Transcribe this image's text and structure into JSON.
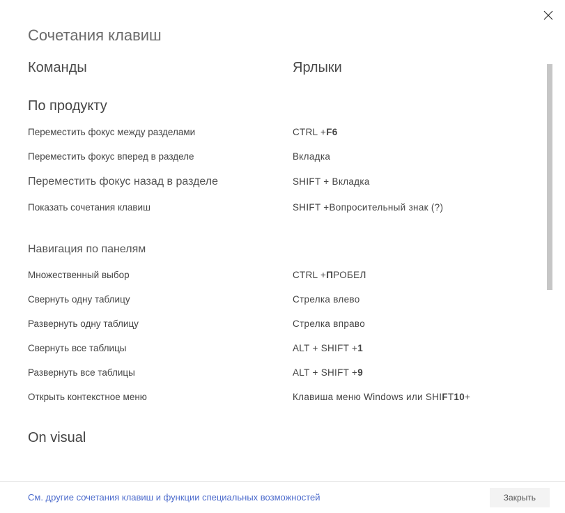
{
  "title": "Сочетания клавиш",
  "headers": {
    "commands": "Команды",
    "shortcuts": "Ярлыки"
  },
  "section1": {
    "title": "По продукту",
    "rows": [
      {
        "cmd": "Переместить фокус между разделами",
        "short": "CTRL +F6"
      },
      {
        "cmd": "Переместить фокус вперед в разделе",
        "short": "Вкладка"
      },
      {
        "cmd": "Переместить фокус назад в разделе",
        "short": "SHIFT + Вкладка",
        "large": true
      },
      {
        "cmd": "Показать сочетания клавиш",
        "short": "SHIFT +Вопросительный знак (?)"
      }
    ]
  },
  "section2": {
    "title": "Навигация по панелям",
    "rows": [
      {
        "cmd": "Множественный выбор",
        "short": "CTRL +ПРОБЕЛ"
      },
      {
        "cmd": "Свернуть одну таблицу",
        "short": "Стрелка влево"
      },
      {
        "cmd": "Развернуть одну таблицу",
        "short": "Стрелка вправо"
      },
      {
        "cmd": "Свернуть все таблицы",
        "short": "ALT + SHIFT +1"
      },
      {
        "cmd": "Развернуть все таблицы",
        "short": "ALT + SHIFT +9"
      },
      {
        "cmd": "Открыть контекстное меню",
        "short": "Клавиша меню Windows или SHIFT+ F10"
      }
    ]
  },
  "cutoff": "On visual",
  "footer": {
    "link": "См. другие сочетания клавиш и функции специальных возможностей",
    "close": "Закрыть"
  }
}
